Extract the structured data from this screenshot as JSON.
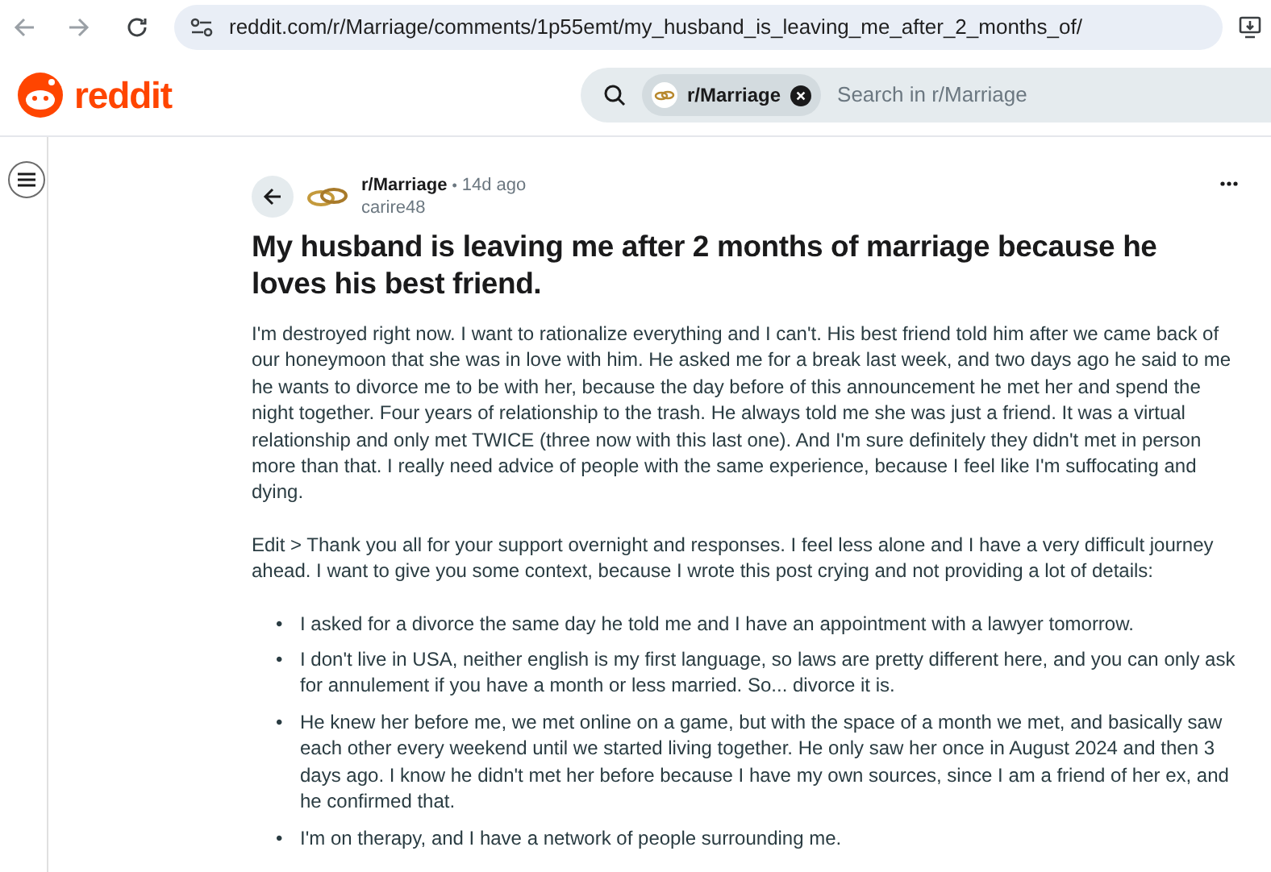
{
  "browser": {
    "url": "reddit.com/r/Marriage/comments/1p55emt/my_husband_is_leaving_me_after_2_months_of/"
  },
  "header": {
    "logo_text": "reddit",
    "search": {
      "community": "r/Marriage",
      "placeholder": "Search in r/Marriage"
    }
  },
  "post": {
    "subreddit": "r/Marriage",
    "separator": "•",
    "time": "14d ago",
    "author": "carire48",
    "title": "My husband is leaving me after 2 months of marriage because he loves his best friend.",
    "paragraphs": [
      "I'm destroyed right now. I want to rationalize everything and I can't. His best friend told him after we came back of our honeymoon that she was in love with him. He asked me for a break last week, and two days ago he said to me he wants to divorce me to be with her, because the day before of this announcement he met her and spend the night together. Four years of relationship to the trash. He always told me she was just a friend. It was a virtual relationship and only met TWICE (three now with this last one). And I'm sure definitely they didn't met in person more than that. I really need advice of people with the same experience, because I feel like I'm suffocating and dying.",
      "Edit > Thank you all for your support overnight and responses. I feel less alone and I have a very difficult journey ahead. I want to give you some context, because I wrote this post crying and not providing a lot of details:"
    ],
    "bullet": "•",
    "bullets": [
      "I asked for a divorce the same day he told me and I have an appointment with a lawyer tomorrow.",
      "I don't live in USA, neither english is my first language, so laws are pretty different here, and you can only ask for annulement if you have a month or less married. So... divorce it is.",
      "He knew her before me, we met online on a game, but with the space of a month we met, and basically saw each other every weekend until we started living together. He only saw her once in August 2024 and then 3 days ago. I know he didn't met her before because I have my own sources, since I am a friend of her ex, and he confirmed that.",
      "I'm on therapy, and I have a network of people surrounding me."
    ]
  }
}
